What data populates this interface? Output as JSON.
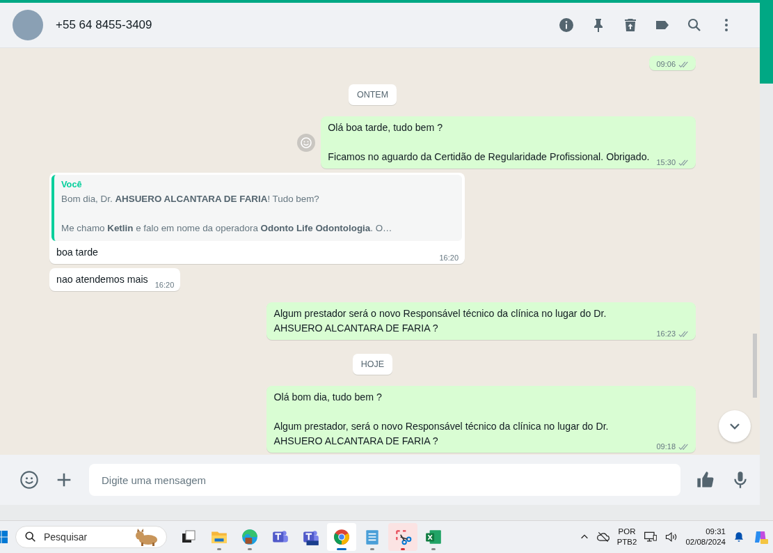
{
  "chat_header": {
    "contact_name": "+55 64 8455-3409"
  },
  "messages": [
    {
      "kind": "outgoing",
      "time": "09:06",
      "read": false
    },
    {
      "kind": "date",
      "text": "ONTEM"
    },
    {
      "kind": "outgoing",
      "text": "Olá boa tarde, tudo bem ?\n\nFicamos no aguardo da Certidão de Regularidade Profissional. Obrigado.",
      "time": "15:30",
      "read": false,
      "reaction_button": true
    },
    {
      "kind": "incoming",
      "quote": {
        "author": "Você",
        "text": "Bom dia, Dr. **AHSUERO ALCANTARA DE FARIA**! Tudo bem?\n\nMe chamo **Ketlin** e falo em nome da operadora **Odonto Life Odontologia**. O…"
      },
      "text": "boa tarde",
      "time": "16:20"
    },
    {
      "kind": "incoming",
      "text": "nao atendemos mais",
      "time": "16:20"
    },
    {
      "kind": "outgoing",
      "text": "Algum prestador será o novo Responsável técnico da clínica no lugar do Dr. AHSUERO ALCANTARA DE FARIA ?",
      "time": "16:23",
      "read": false
    },
    {
      "kind": "date",
      "text": "HOJE"
    },
    {
      "kind": "outgoing",
      "text": "Olá bom dia, tudo bem ?\n\nAlgum prestador, será o novo Responsável técnico da clínica no lugar do Dr. AHSUERO ALCANTARA DE FARIA ?",
      "time": "09:18",
      "read": false
    }
  ],
  "composer": {
    "placeholder": "Digite uma mensagem"
  },
  "taskbar": {
    "search": {
      "placeholder": "Pesquisar"
    },
    "apps": [
      {
        "kind": "task-view",
        "running": false,
        "selected": false,
        "attention": false
      },
      {
        "kind": "folder",
        "running": true,
        "selected": false,
        "attention": false
      },
      {
        "kind": "edge",
        "running": true,
        "selected": false,
        "attention": false
      },
      {
        "kind": "teams",
        "running": false,
        "selected": false,
        "attention": false
      },
      {
        "kind": "teams-new",
        "running": false,
        "selected": false,
        "attention": false
      },
      {
        "kind": "chrome",
        "running": true,
        "selected": true,
        "attention": false
      },
      {
        "kind": "notepad",
        "running": true,
        "selected": false,
        "attention": false
      },
      {
        "kind": "snipping",
        "running": true,
        "selected": false,
        "attention": true
      },
      {
        "kind": "excel",
        "running": true,
        "selected": false,
        "attention": false
      }
    ],
    "tray": {
      "language": "POR",
      "layout": "PTB2",
      "time": "09:31",
      "date": "02/08/2024"
    }
  }
}
